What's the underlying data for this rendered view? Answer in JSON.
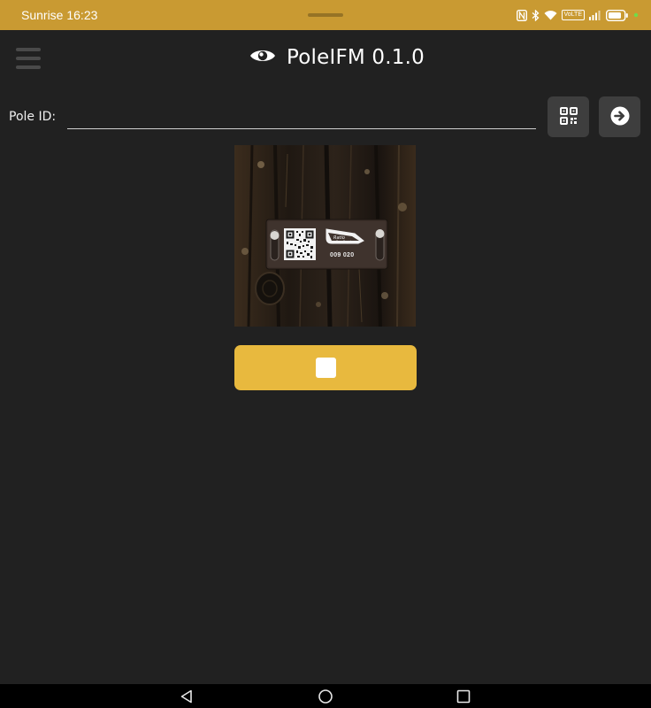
{
  "status_bar": {
    "carrier_time": "Sunrise 16:23",
    "volte_label": "VoLTE",
    "icons": [
      "nfc-icon",
      "bluetooth-icon",
      "wifi-icon",
      "volte-icon",
      "signal-icon",
      "battery-icon",
      "notification-dot-icon"
    ],
    "background_color": "#c99a32"
  },
  "header": {
    "title": "PoleIFM 0.1.0",
    "logo_icon": "eye-icon",
    "menu_icon": "hamburger-menu-icon"
  },
  "pole_form": {
    "label": "Pole ID:",
    "input_value": "",
    "input_placeholder": "",
    "qr_button_icon": "qr-code-scan-icon",
    "go_button_icon": "arrow-right-circle-icon"
  },
  "photo": {
    "tag_number": "009 020",
    "description_icon": "pole-tag-photo"
  },
  "stop_button": {
    "icon": "stop-icon",
    "color": "#e8b93e"
  },
  "nav_bar": {
    "icons": [
      "back-triangle-icon",
      "home-circle-icon",
      "recents-square-icon"
    ]
  }
}
